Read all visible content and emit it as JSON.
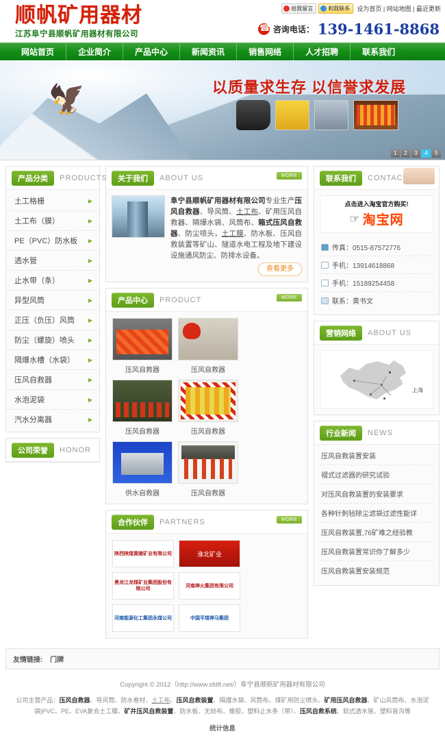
{
  "header": {
    "logo_title": "顺帆矿用器材",
    "logo_sub": "江苏阜宁县顺帆矿用器材有限公司",
    "im_qq": "给我留言",
    "im_ali": "和我联系",
    "top_links": "设为首页 | 网站地图 | 最近更新",
    "phone_label": "咨询电话：",
    "phone_number": "139-1461-8868"
  },
  "nav": {
    "items": [
      {
        "label": "网站首页"
      },
      {
        "label": "企业简介"
      },
      {
        "label": "产品中心"
      },
      {
        "label": "新闻资讯"
      },
      {
        "label": "销售网络"
      },
      {
        "label": "人才招聘"
      },
      {
        "label": "联系我们"
      }
    ]
  },
  "banner": {
    "slogan": "以质量求生存  以信誉求发展",
    "pages": [
      "1",
      "2",
      "3",
      "4",
      "5"
    ],
    "active_page": "4"
  },
  "sidebar": {
    "title": "产品分类",
    "title_en": "PRODUCTS",
    "items": [
      {
        "label": "土工格栅"
      },
      {
        "label": "土工布（膜）"
      },
      {
        "label": "PE（PVC）防水板"
      },
      {
        "label": "透水管"
      },
      {
        "label": "止水带（条）"
      },
      {
        "label": "异型风筒"
      },
      {
        "label": "正压（负压）风筒"
      },
      {
        "label": "防尘（螺旋）喷头"
      },
      {
        "label": "隔爆水槽（水袋）"
      },
      {
        "label": "压风自救器"
      },
      {
        "label": "水泡泥袋"
      },
      {
        "label": "汽水分离器"
      }
    ],
    "honor_title": "公司荣誉",
    "honor_en": "HONOR"
  },
  "about": {
    "title": "关于我们",
    "title_en": "ABOUT US",
    "more": "MORE",
    "body_1": "阜宁县顺帆矿用器材有限公司",
    "body_2": "专业生产",
    "body_3": "压风自救器",
    "body_4": "、导风筒、",
    "body_5": "土工布",
    "body_6": "、矿用压风自救器、隔爆水袋、风筒布、",
    "body_7": "箱式压风自救器",
    "body_8": "、防尘喷头，",
    "body_9": "土工膜",
    "body_10": "、防水板、压风自救装置等矿山、隧道水电工程及地下建设设施通风防尘、防排水设备。",
    "more_pill": "查看更多"
  },
  "product": {
    "title": "产品中心",
    "title_en": "PRODUCT",
    "more": "MORE",
    "items": [
      {
        "caption": "压风自救器"
      },
      {
        "caption": "压风自救器"
      },
      {
        "caption": "压风自救器"
      },
      {
        "caption": "压风自救器"
      },
      {
        "caption": "供水自救器"
      },
      {
        "caption": "压风自救器"
      }
    ]
  },
  "partners": {
    "title": "合作伙伴",
    "title_en": "PARTNERS",
    "more": "MORE",
    "items": [
      {
        "label": "陕西陕煤黄陵矿业有限公司"
      },
      {
        "label": "淮北矿业"
      },
      {
        "label": "黑龙江龙煤矿业集团股份有限公司"
      },
      {
        "label": "河南神火集团有限公司"
      },
      {
        "label": "河南能源化工集团永煤公司"
      },
      {
        "label": "中国平煤神马集团"
      }
    ]
  },
  "contact": {
    "title": "联系我们",
    "title_en": "CONTACT",
    "taobao_tip": "点击进入淘宝官方购买!",
    "taobao_word": "淘宝网",
    "items": [
      {
        "label": "传真：0515-87572776"
      },
      {
        "label": "手机：13914618868"
      },
      {
        "label": "手机：15189254458"
      },
      {
        "label": "联系：黄书文"
      }
    ]
  },
  "network": {
    "title": "营销网络",
    "title_en": "ABOUT US",
    "map_label": "上海"
  },
  "news": {
    "title": "行业新闻",
    "title_en": "NEWS",
    "items": [
      {
        "label": "压风自救装置安装"
      },
      {
        "label": "褶式过滤器的研究试验"
      },
      {
        "label": "对压风自救装置的安装要求"
      },
      {
        "label": "各种针刺毡除尘滤袋过滤性能详"
      },
      {
        "label": "压风自救装置,76矿难之经验教"
      },
      {
        "label": "压风自救装置常识你了解多少"
      },
      {
        "label": "压风自救装置安装规范"
      }
    ]
  },
  "friendly_links": {
    "label": "友情链接:",
    "items": [
      {
        "label": "门牌"
      }
    ]
  },
  "footer": {
    "copyright": "Copyright © 2012（http://www.sfdft.net/）阜宁县顺帆矿用器材有限公司",
    "products_prefix": "公司主营产品：",
    "p1": "压风自救器",
    "p2": "、导风筒、防水卷材、",
    "p3": "土工布",
    "p4": "、",
    "p5": "压风自救装置",
    "p6": "、隔爆水袋、风筒布、煤矿用防尘喷头、",
    "p7": "矿用压风自救器",
    "p8": "、矿山风筒布、水泡泥袋|PVC、PE、EVA复合土工膜、",
    "p9": "矿井压风自救装置",
    "p10": "、防水板、无妨布、橡胶、塑料止水条（带）、",
    "p11": "压风自救系统",
    "p12": "、软式透水管、塑料盲沟等",
    "stats": "统计信息"
  },
  "colors": {
    "brand_green": "#5f9e19",
    "nav_green": "#159015",
    "logo_red": "#d81f06",
    "phone_blue": "#1a3fa0",
    "taobao_orange": "#ff4400",
    "accent_cyan": "#3ec6ef"
  }
}
